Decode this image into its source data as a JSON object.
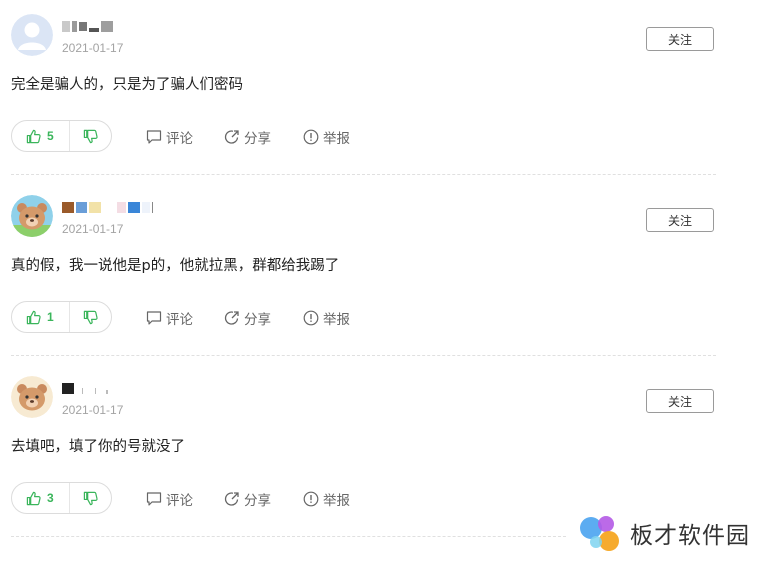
{
  "comments": [
    {
      "date": "2021-01-17",
      "follow_label": "关注",
      "text": "完全是骗人的，只是为了骗人们密码",
      "likes": "5",
      "actions": {
        "comment": "评论",
        "share": "分享",
        "report": "举报"
      }
    },
    {
      "date": "2021-01-17",
      "follow_label": "关注",
      "text": "真的假，我一说他是p的，他就拉黑，群都给我踢了",
      "likes": "1",
      "actions": {
        "comment": "评论",
        "share": "分享",
        "report": "举报"
      }
    },
    {
      "date": "2021-01-17",
      "follow_label": "关注",
      "text": "去填吧，填了你的号就没了",
      "likes": "3",
      "actions": {
        "comment": "评论",
        "share": "分享",
        "report": "举报"
      }
    }
  ],
  "watermark": {
    "text": "板才软件园"
  },
  "colors": {
    "like_green": "#3ab55b",
    "text_gray": "#666666",
    "date_gray": "#a3a3a3"
  }
}
